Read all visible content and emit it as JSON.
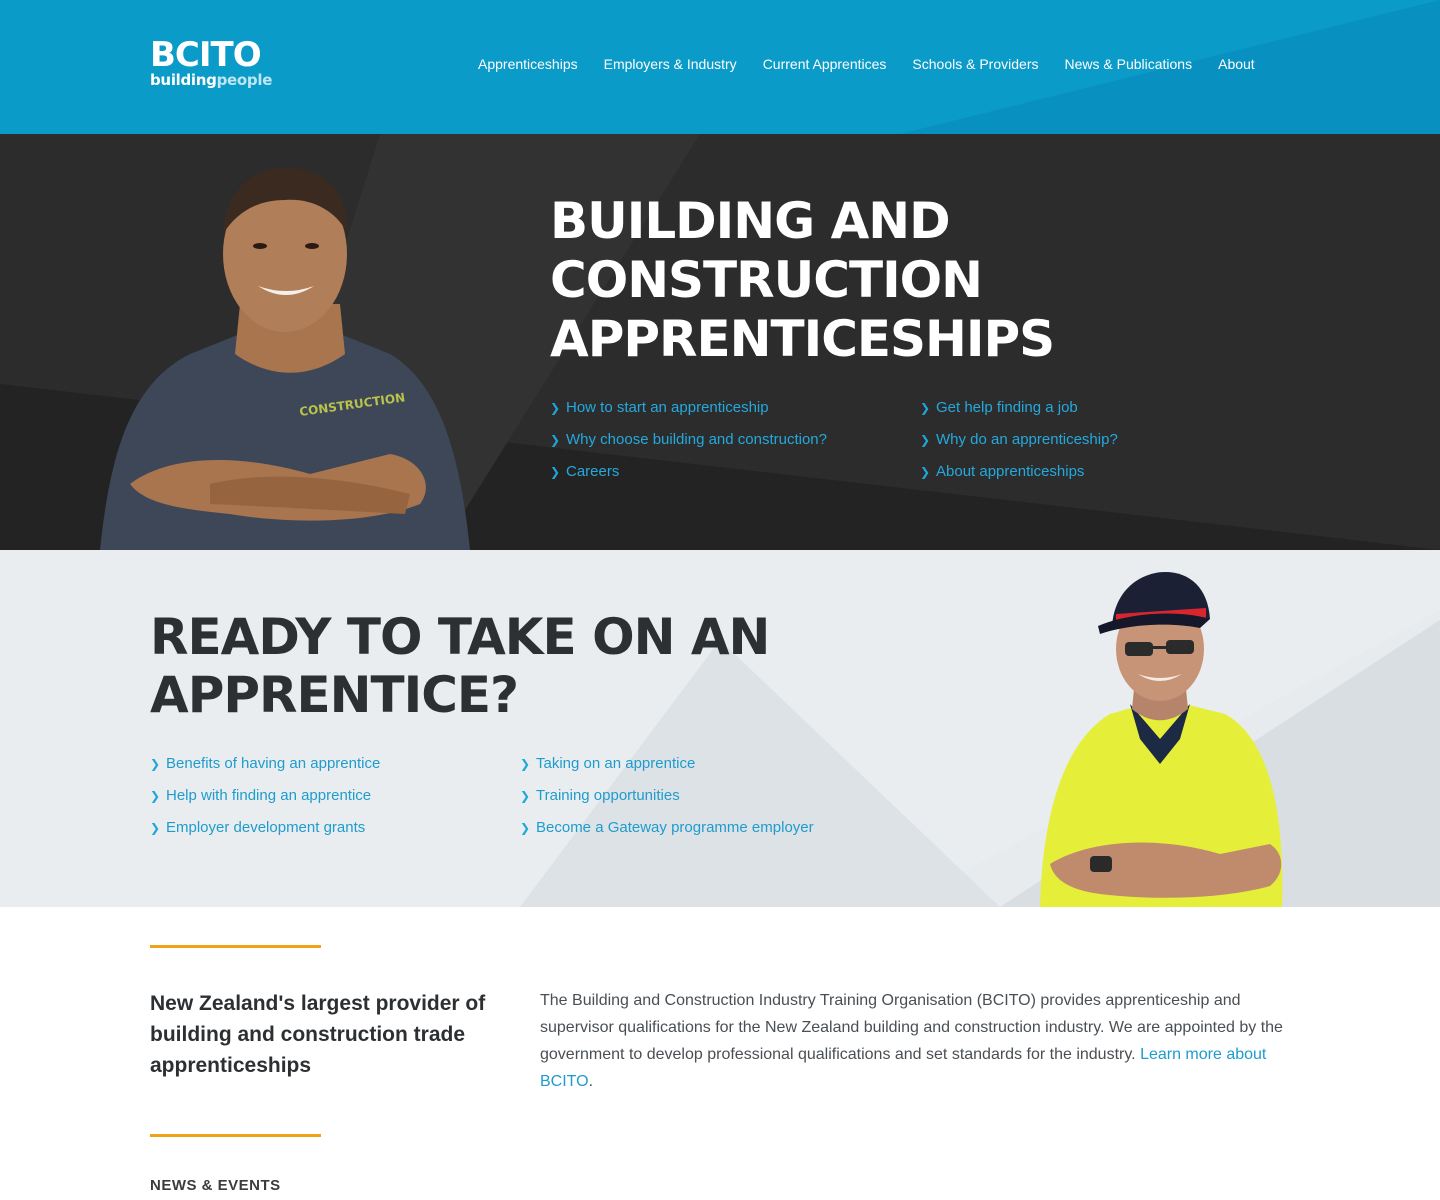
{
  "header": {
    "logo_main": "BCITO",
    "logo_sub_a": "building",
    "logo_sub_b": "people",
    "nav": [
      "Apprenticeships",
      "Employers & Industry",
      "Current Apprentices",
      "Schools & Providers",
      "News & Publications",
      "About"
    ]
  },
  "hero": {
    "title_lines": [
      "BUILDING AND",
      "CONSTRUCTION",
      "APPRENTICESHIPS"
    ],
    "links": [
      "How to start an apprenticeship",
      "Get help finding a job",
      "Why choose building and construction?",
      "Why do an apprenticeship?",
      "Careers",
      "About apprenticeships"
    ],
    "shirt_text": "CONSTRUCTION"
  },
  "employer": {
    "title_lines": [
      "READY TO TAKE ON AN",
      "APPRENTICE?"
    ],
    "links": [
      "Benefits of having an apprentice",
      "Taking on an apprentice",
      "Help with finding an apprentice",
      "Training opportunities",
      "Employer development grants",
      "Become a Gateway programme employer"
    ]
  },
  "intro": {
    "heading": "New Zealand's largest provider of building and construction trade apprenticeships",
    "body": "The Building and Construction Industry Training Organisation (BCITO) provides apprenticeship and supervisor qualifications for the New Zealand building and construction industry. We are appointed by the government to develop professional qualifications and set standards for the industry.",
    "link": "Learn more about BCITO",
    "suffix": "."
  },
  "news": {
    "heading": "NEWS & EVENTS"
  },
  "icons": {
    "link_chevron": "chevron-right-icon"
  },
  "colors": {
    "header_blue": "#0a9bc8",
    "hero_dark": "#2c2c2d",
    "link_blue": "#1e9ccd",
    "accent_orange": "#f0a318",
    "employer_bg": "#e7ebee"
  }
}
